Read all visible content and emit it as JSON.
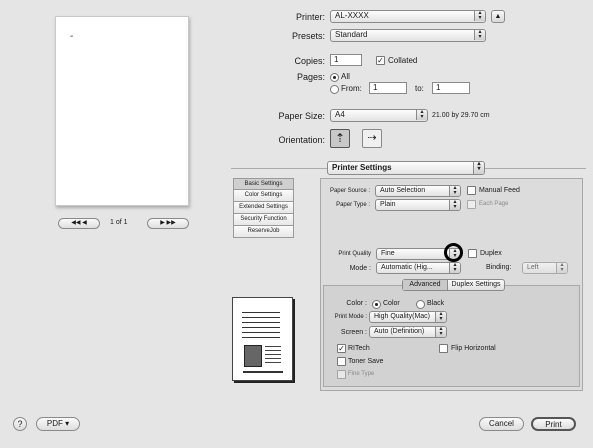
{
  "printer": {
    "label": "Printer:",
    "value": "AL-XXXX"
  },
  "presets": {
    "label": "Presets:",
    "value": "Standard"
  },
  "copies": {
    "label": "Copies:",
    "value": "1",
    "collated_label": "Collated",
    "collated": true
  },
  "pages": {
    "label": "Pages:",
    "all_label": "All",
    "from_label": "From:",
    "from_value": "1",
    "to_label": "to:",
    "to_value": "1",
    "selected": "All"
  },
  "paper_size": {
    "label": "Paper Size:",
    "value": "A4",
    "dimensions": "21.00 by 29.70 cm"
  },
  "orientation": {
    "label": "Orientation:"
  },
  "section_menu": {
    "value": "Printer Settings"
  },
  "preview_nav": {
    "prev_label": "◀◀ ◀",
    "page_text": "1 of 1",
    "next_label": "▶ ▶▶",
    "cursor": "-"
  },
  "tabs": [
    {
      "label": "Basic Settings",
      "active": true
    },
    {
      "label": "Color Settings",
      "active": false
    },
    {
      "label": "Extended Settings",
      "active": false
    },
    {
      "label": "Security Function",
      "active": false
    },
    {
      "label": "ReserveJob",
      "active": false
    }
  ],
  "paper_source": {
    "label": "Paper Source :",
    "value": "Auto Selection",
    "manual_feed_label": "Manual Feed",
    "manual_feed": false
  },
  "paper_type": {
    "label": "Paper Type :",
    "value": "Plain",
    "each_page_label": "Each Page",
    "each_page": false
  },
  "print_quality": {
    "label": "Print Quality",
    "value": "Fine",
    "duplex_label": "Duplex",
    "duplex": false
  },
  "mode": {
    "label": "Mode :",
    "value": "Automatic (Hig...",
    "binding_label": "Binding:",
    "binding_value": "Left"
  },
  "advanced_buttons": {
    "advanced": "Advanced",
    "duplex_settings": "Duplex Settings"
  },
  "color": {
    "label": "Color :",
    "color_option": "Color",
    "black_option": "Black",
    "selected": "Color"
  },
  "print_mode": {
    "label": "Print Mode :",
    "value": "High Quality(Mac)"
  },
  "screen": {
    "label": "Screen :",
    "value": "Auto (Definition)"
  },
  "ritech": {
    "label": "RITech",
    "checked": true
  },
  "flip_horizontal": {
    "label": "Flip Horizontal",
    "checked": false
  },
  "toner_save": {
    "label": "Toner Save",
    "checked": false
  },
  "fine_type": {
    "label": "Fine Type",
    "checked": false
  },
  "footer": {
    "help": "?",
    "pdf_label": "PDF ▾",
    "cancel_label": "Cancel",
    "print_label": "Print"
  }
}
